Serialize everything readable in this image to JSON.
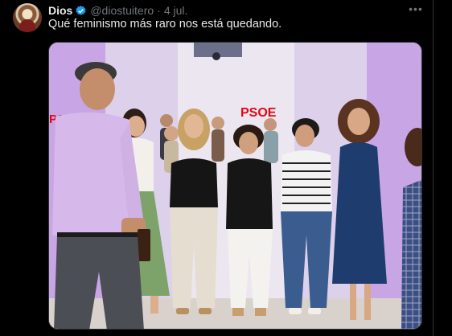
{
  "tweet": {
    "display_name": "Dios",
    "handle": "@diostuitero",
    "separator": "·",
    "date": "4 jul.",
    "more_label": "•••",
    "text": "Qué feminismo más raro nos está quedando."
  },
  "media": {
    "sign_left": "PSOE",
    "sign_center": "PSOE"
  },
  "colors": {
    "background": "#000000",
    "text_primary": "#e7e9ea",
    "text_secondary": "#71767b",
    "verified_blue": "#1d9bf0",
    "psoe_red": "#e30613"
  },
  "icons": {
    "verified": "verified-badge-icon",
    "more": "more-options-icon"
  }
}
